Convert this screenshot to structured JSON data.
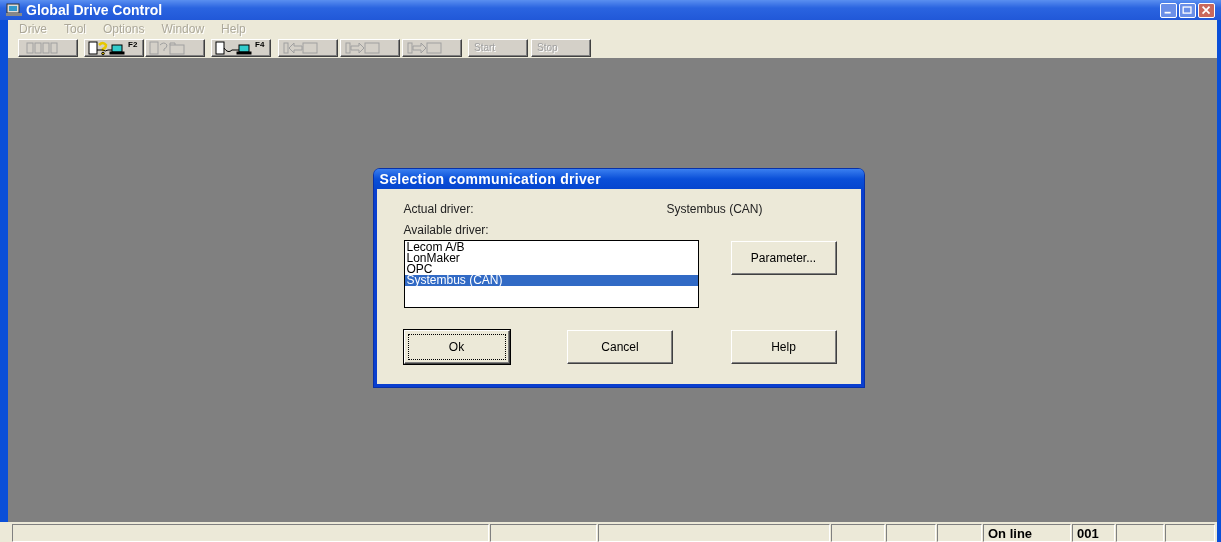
{
  "window": {
    "title": "Global Drive Control"
  },
  "menu": [
    {
      "label": "Drive",
      "disabled": true
    },
    {
      "label": "Tool",
      "disabled": true
    },
    {
      "label": "Options",
      "disabled": true
    },
    {
      "label": "Window",
      "disabled": true
    },
    {
      "label": "Help",
      "disabled": true
    }
  ],
  "toolbar": [
    {
      "kind": "icon",
      "disabled": true
    },
    {
      "kind": "icon",
      "key": "F2",
      "disabled": false
    },
    {
      "kind": "icon",
      "disabled": true
    },
    {
      "kind": "icon",
      "key": "F4",
      "disabled": false
    },
    {
      "kind": "icon",
      "disabled": true
    },
    {
      "kind": "icon",
      "disabled": true
    },
    {
      "kind": "icon",
      "disabled": true
    },
    {
      "kind": "text",
      "label": "Start",
      "disabled": true
    },
    {
      "kind": "text",
      "label": "Stop",
      "disabled": true
    }
  ],
  "dialog": {
    "title": "Selection communication driver",
    "actual_label": "Actual driver:",
    "actual_value": "Systembus (CAN)",
    "available_label": "Available driver:",
    "drivers": [
      {
        "label": "Lecom A/B",
        "selected": false
      },
      {
        "label": "LonMaker",
        "selected": false
      },
      {
        "label": "OPC",
        "selected": false
      },
      {
        "label": "Systembus (CAN)",
        "selected": true
      }
    ],
    "parameter_button": "Parameter...",
    "buttons": [
      {
        "label": "Ok",
        "focused": true
      },
      {
        "label": "Cancel",
        "focused": false
      },
      {
        "label": "Help",
        "focused": false
      }
    ]
  },
  "status_bar": {
    "connection": "On line",
    "address": "001"
  }
}
